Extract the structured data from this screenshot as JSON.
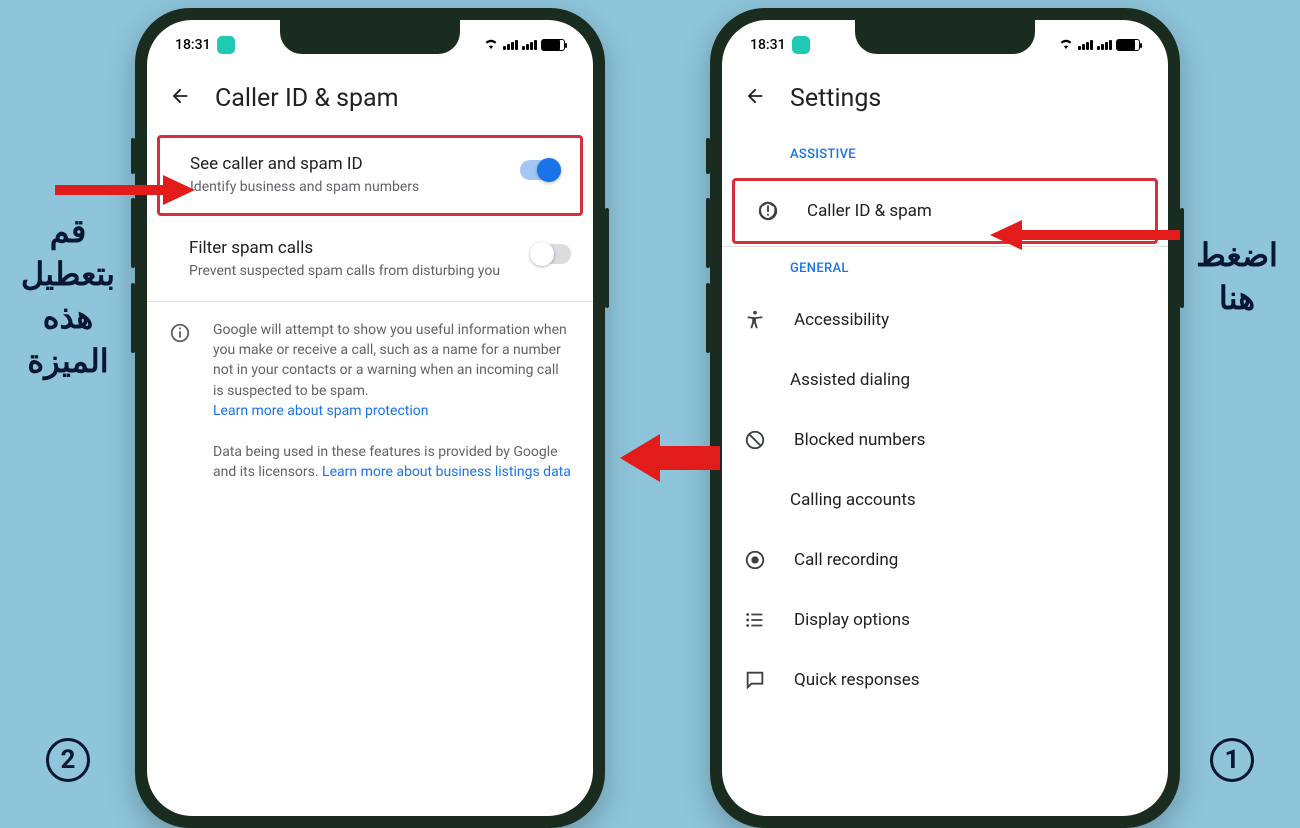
{
  "status": {
    "time": "18:31"
  },
  "annotations": {
    "left_text": "قم بتعطيل هذه الميزة",
    "right_text": "اضغط هنا",
    "step1": "1",
    "step2": "2"
  },
  "phone_right": {
    "title": "Settings",
    "sections": {
      "assistive_label": "ASSISTIVE",
      "general_label": "GENERAL"
    },
    "items": {
      "caller_id": "Caller ID & spam",
      "accessibility": "Accessibility",
      "assisted_dialing": "Assisted dialing",
      "blocked_numbers": "Blocked numbers",
      "calling_accounts": "Calling accounts",
      "call_recording": "Call recording",
      "display_options": "Display options",
      "quick_responses": "Quick responses"
    }
  },
  "phone_left": {
    "title": "Caller ID & spam",
    "settings": {
      "see_caller": {
        "title": "See caller and spam ID",
        "desc": "Identify business and spam numbers"
      },
      "filter_spam": {
        "title": "Filter spam calls",
        "desc": "Prevent suspected spam calls from disturbing you"
      }
    },
    "info": {
      "p1": "Google will attempt to show you useful information when you make or receive a call, such as a name for a number not in your contacts or a warning when an incoming call is suspected to be spam.",
      "link1": "Learn more about spam protection",
      "p2a": "Data being used in these features is provided by Google and its licensors. ",
      "link2": "Learn more about business listings data"
    }
  }
}
